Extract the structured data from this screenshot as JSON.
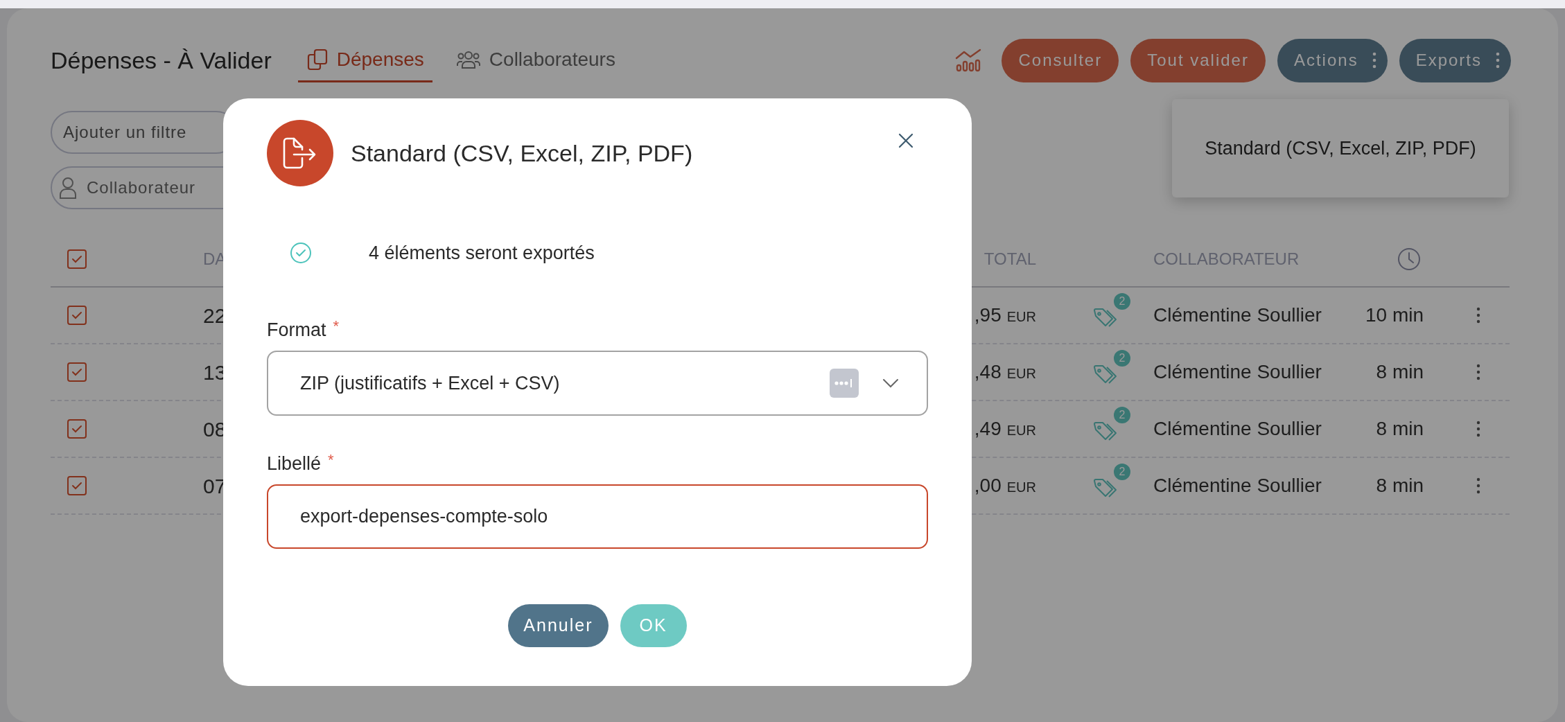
{
  "page": {
    "title": "Dépenses - À Valider",
    "tabs": [
      {
        "label": "Dépenses",
        "selected": true
      },
      {
        "label": "Collaborateurs",
        "selected": false
      }
    ],
    "buttons": [
      {
        "label": "Consulter",
        "kind": "primary"
      },
      {
        "label": "Tout valider",
        "kind": "primary"
      },
      {
        "label": "Actions",
        "kind": "menu"
      },
      {
        "label": "Exports",
        "kind": "menu"
      }
    ],
    "exports_menu": {
      "items": [
        "Standard (CSV, Excel, ZIP, PDF)"
      ]
    },
    "filters": {
      "add_filter": "Ajouter un filtre",
      "collaborator_placeholder": "Collaborateur"
    },
    "table": {
      "select_all_checked": true,
      "columns": {
        "column_2": "DA",
        "total": "TOTAL",
        "collaborator": "COLLABORATEUR"
      },
      "rows": [
        {
          "checked": true,
          "column_2": "22",
          "total": ",95",
          "currency": "EUR",
          "tag_count": "2",
          "collaborator": "Clémentine Soullier",
          "age": "10 min"
        },
        {
          "checked": true,
          "column_2": "13",
          "total": ",48",
          "currency": "EUR",
          "tag_count": "2",
          "collaborator": "Clémentine Soullier",
          "age": "8 min"
        },
        {
          "checked": true,
          "column_2": "08",
          "total": ",49",
          "currency": "EUR",
          "tag_count": "2",
          "collaborator": "Clémentine Soullier",
          "age": "8 min"
        },
        {
          "checked": true,
          "column_2": "07",
          "total": ",00",
          "currency": "EUR",
          "tag_count": "2",
          "collaborator": "Clémentine Soullier",
          "age": "8 min"
        }
      ]
    }
  },
  "dialog": {
    "title": "Standard (CSV, Excel, ZIP, PDF)",
    "info": "4 éléments seront exportés",
    "fields": [
      {
        "kind": "select",
        "label": "Format",
        "required_mark": "*",
        "value": "ZIP (justificatifs + Excel + CSV)",
        "focused": false
      },
      {
        "kind": "text",
        "label": "Libellé",
        "required_mark": "*",
        "value": "export-depenses-compte-solo",
        "focused": true
      }
    ],
    "buttons": [
      {
        "label": "Annuler",
        "kind": "secondary"
      },
      {
        "label": "OK",
        "kind": "confirm"
      }
    ]
  }
}
